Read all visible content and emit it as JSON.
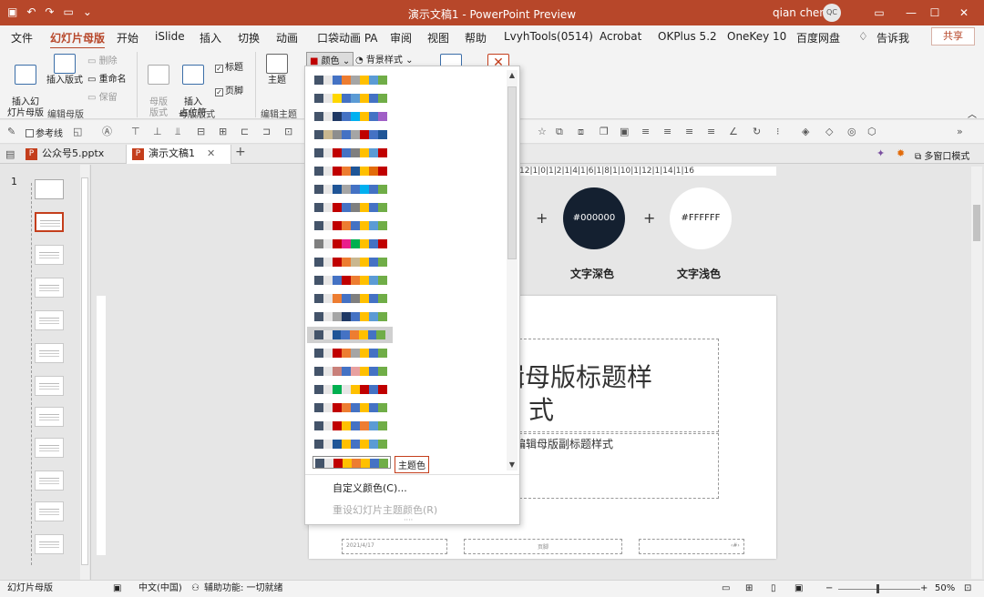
{
  "window": {
    "title": "演示文稿1  -  PowerPoint Preview",
    "user": "qian chen",
    "avatar_initials": "QC",
    "accent": "#b7472a"
  },
  "tabs": [
    {
      "label": "文件"
    },
    {
      "label": "幻灯片母版"
    },
    {
      "label": "开始"
    },
    {
      "label": "iSlide"
    },
    {
      "label": "插入"
    },
    {
      "label": "切换"
    },
    {
      "label": "动画"
    },
    {
      "label": "口袋动画 PA"
    },
    {
      "label": "审阅"
    },
    {
      "label": "视图"
    },
    {
      "label": "帮助"
    },
    {
      "label": "LvyhTools(0514)"
    },
    {
      "label": "Acrobat"
    },
    {
      "label": "OKPlus 5.2"
    },
    {
      "label": "OneKey 10"
    },
    {
      "label": "百度网盘"
    },
    {
      "label": "告诉我"
    }
  ],
  "share_label": "共享",
  "ribbon": {
    "insert_slide_master": "插入幻\n灯片母版",
    "insert_layout": "插入版式",
    "delete": "删除",
    "rename": "重命名",
    "preserve": "保留",
    "group_edit_master": "编辑母版",
    "master_layout": "母版\n版式",
    "insert_placeholder": "插入\n占位符",
    "title_check": "标题",
    "footer_check": "页脚",
    "group_master_layout": "母版版式",
    "theme": "主题",
    "group_edit_theme": "编辑主题",
    "colors_btn": "颜色",
    "background_styles": "背景样式"
  },
  "toolrow": {
    "guides_label": "参考线",
    "multiwindow": "多窗口模式"
  },
  "doctabs": [
    {
      "label": "公众号5.pptx"
    },
    {
      "label": "演示文稿1"
    }
  ],
  "thumbs": {
    "slide_number": "1"
  },
  "ruler_text": "12|1|0|1|2|1|4|1|6|1|8|1|10|1|12|1|14|1|16",
  "canvas": {
    "dark_hex": "#000000",
    "light_hex": "#FFFFFF",
    "dark_label": "文字深色",
    "light_label": "文字浅色",
    "title_line1": "编辑母版标题样",
    "title_line2": "式",
    "subtitle": "编辑母版副标题样式",
    "footer_date": "2021/4/17",
    "footer_text": "页脚",
    "footer_num": "‹#›"
  },
  "palettes": [
    [
      "#44546a",
      "#e7e6e6",
      "#4472c4",
      "#ed7d31",
      "#a5a5a5",
      "#ffc000",
      "#5b9bd5",
      "#70ad47"
    ],
    [
      "#44546a",
      "#e7e6e6",
      "#ffd700",
      "#4472c4",
      "#5b9bd5",
      "#ffc000",
      "#4472c4",
      "#70ad47"
    ],
    [
      "#44546a",
      "#e7e6e6",
      "#1f3864",
      "#4472c4",
      "#00b0f0",
      "#ffc000",
      "#4472c4",
      "#a05fc6"
    ],
    [
      "#44546a",
      "#c9b78f",
      "#8e8e8e",
      "#4472c4",
      "#a5a5a5",
      "#c00000",
      "#4472c4",
      "#1f5597"
    ],
    [
      "#44546a",
      "#e7e6e6",
      "#c00000",
      "#4472c4",
      "#7f7f7f",
      "#ffc000",
      "#5b9bd5",
      "#c00000"
    ],
    [
      "#44546a",
      "#e7e6e6",
      "#c00000",
      "#ed7d31",
      "#1f5597",
      "#ffc000",
      "#e26b0a",
      "#c00000"
    ],
    [
      "#44546a",
      "#e7e6e6",
      "#1f5597",
      "#a5a5a5",
      "#4472c4",
      "#00b0f0",
      "#4472c4",
      "#70ad47"
    ],
    [
      "#44546a",
      "#e7e6e6",
      "#c00000",
      "#4472c4",
      "#7f7f7f",
      "#ffc000",
      "#4472c4",
      "#70ad47"
    ],
    [
      "#44546a",
      "#e7e6e6",
      "#c00000",
      "#ed7d31",
      "#4472c4",
      "#ffc000",
      "#5b9bd5",
      "#70ad47"
    ],
    [
      "#7f7f7f",
      "#e7e6e6",
      "#c00000",
      "#e91e8c",
      "#00b050",
      "#ffc000",
      "#4472c4",
      "#c00000"
    ],
    [
      "#44546a",
      "#e7e6e6",
      "#c00000",
      "#ed7d31",
      "#c9b78f",
      "#ffc000",
      "#4472c4",
      "#70ad47"
    ],
    [
      "#44546a",
      "#e7e6e6",
      "#4472c4",
      "#c00000",
      "#ed7d31",
      "#ffc000",
      "#5b9bd5",
      "#70ad47"
    ],
    [
      "#44546a",
      "#e7e6e6",
      "#ed7d31",
      "#4472c4",
      "#7f7f7f",
      "#ffc000",
      "#4472c4",
      "#70ad47"
    ],
    [
      "#44546a",
      "#e7e6e6",
      "#a5a5a5",
      "#1f3864",
      "#4472c4",
      "#ffc000",
      "#5b9bd5",
      "#70ad47"
    ],
    [
      "#44546a",
      "#e7e6e6",
      "#1f5597",
      "#4472c4",
      "#ed7d31",
      "#ffc000",
      "#4472c4",
      "#70ad47"
    ],
    [
      "#44546a",
      "#e7e6e6",
      "#c00000",
      "#ed7d31",
      "#a5a5a5",
      "#ffc000",
      "#4472c4",
      "#70ad47"
    ],
    [
      "#44546a",
      "#e7e6e6",
      "#c9807a",
      "#4472c4",
      "#e8a0a0",
      "#ffc000",
      "#4472c4",
      "#70ad47"
    ],
    [
      "#44546a",
      "#e7e6e6",
      "#00b050",
      "#e7e6e6",
      "#ffc000",
      "#c00000",
      "#4472c4",
      "#c00000"
    ],
    [
      "#44546a",
      "#e7e6e6",
      "#c00000",
      "#ed7d31",
      "#4472c4",
      "#ffc000",
      "#4472c4",
      "#70ad47"
    ],
    [
      "#44546a",
      "#e7e6e6",
      "#c00000",
      "#ffc000",
      "#4472c4",
      "#ed7d31",
      "#5b9bd5",
      "#70ad47"
    ],
    [
      "#44546a",
      "#e7e6e6",
      "#1f5597",
      "#ffc000",
      "#4472c4",
      "#ffc000",
      "#5b9bd5",
      "#70ad47"
    ],
    [
      "#44546a",
      "#e7e6e6",
      "#c00000",
      "#ffc000",
      "#ed7d31",
      "#ffc000",
      "#4472c4",
      "#70ad47"
    ]
  ],
  "dropdown": {
    "tooltip": "主题色",
    "custom_colors": "自定义颜色(C)...",
    "reset_colors": "重设幻灯片主题颜色(R)"
  },
  "status": {
    "view": "幻灯片母版",
    "language": "中文(中国)",
    "accessibility": "辅助功能: 一切就绪",
    "zoom": "50%"
  }
}
